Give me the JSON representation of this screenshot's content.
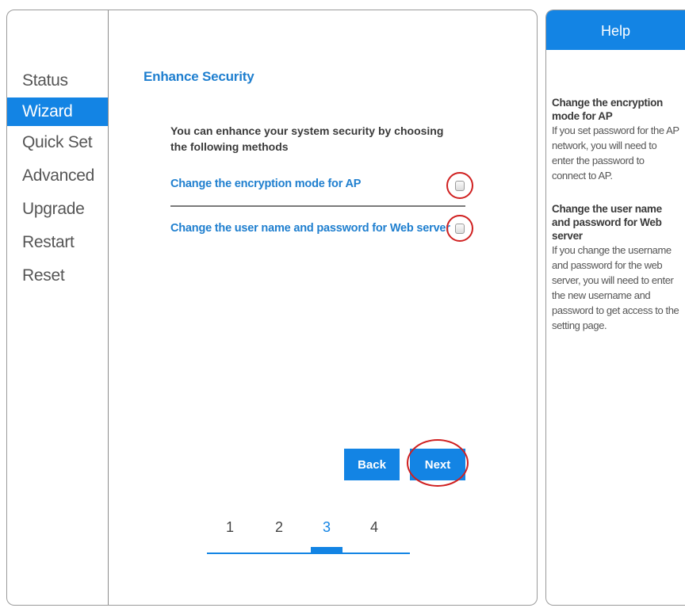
{
  "sidebar": {
    "items": [
      {
        "label": "Status"
      },
      {
        "label": "Wizard",
        "active": true
      },
      {
        "label": "Quick Set"
      },
      {
        "label": "Advanced"
      },
      {
        "label": "Upgrade"
      },
      {
        "label": "Restart"
      },
      {
        "label": "Reset"
      }
    ]
  },
  "main": {
    "title": "Enhance Security",
    "intro": "You can enhance your system security by choosing the following methods",
    "options": [
      {
        "label": "Change the encryption mode for AP",
        "checked": false
      },
      {
        "label": "Change the user name and password for Web server",
        "checked": false
      }
    ],
    "buttons": {
      "back": "Back",
      "next": "Next"
    },
    "steps": {
      "items": [
        "1",
        "2",
        "3",
        "4"
      ],
      "current": "3"
    }
  },
  "help": {
    "title": "Help",
    "sections": [
      {
        "heading": "Change the encryption mode for AP",
        "text": "If you set password for the AP network, you will need to enter the password to connect to AP."
      },
      {
        "heading": "Change the user name and password for Web server",
        "text": "If you change the username and password for the web server, you will need to enter the new username and password to get access to the setting page."
      }
    ]
  },
  "colors": {
    "accent": "#1384e4",
    "link": "#1f7fcf",
    "highlight_ring": "#d02020"
  }
}
